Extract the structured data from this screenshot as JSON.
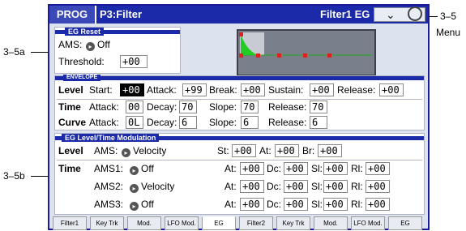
{
  "callouts": {
    "menu_ref": "3–5",
    "menu_label": "Menu",
    "eg_reset_ref": "3–5a",
    "eg_mod_ref": "3–5b"
  },
  "header": {
    "mode": "PROG",
    "page": "P3:Filter",
    "subpage": "Filter1 EG"
  },
  "eg_reset": {
    "title": "EG Reset",
    "ams_label": "AMS:",
    "ams_value": "Off",
    "threshold_label": "Threshold:",
    "threshold_value": "+00"
  },
  "envelope": {
    "title": "ENVELOPE",
    "level_label": "Level",
    "time_label": "Time",
    "curve_label": "Curve",
    "level": {
      "start_label": "Start:",
      "start": "+00",
      "attack_label": "Attack:",
      "attack": "+99",
      "break_label": "Break:",
      "break": "+00",
      "sustain_label": "Sustain:",
      "sustain": "+00",
      "release_label": "Release:",
      "release": "+00"
    },
    "time": {
      "attack_label": "Attack:",
      "attack": "00",
      "decay_label": "Decay:",
      "decay": "70",
      "slope_label": "Slope:",
      "slope": "70",
      "release_label": "Release:",
      "release": "70"
    },
    "curve": {
      "attack_label": "Attack:",
      "attack": "0L",
      "decay_label": "Decay:",
      "decay": "6",
      "slope_label": "Slope:",
      "slope": "6",
      "release_label": "Release:",
      "release": "6"
    }
  },
  "modulation": {
    "title": "EG Level/Time Modulation",
    "level_label": "Level",
    "time_label": "Time",
    "level_row": {
      "ams_label": "AMS:",
      "ams": "Velocity",
      "st_label": "St:",
      "st": "+00",
      "at_label": "At:",
      "at": "+00",
      "br_label": "Br:",
      "br": "+00"
    },
    "time_rows": [
      {
        "ams_label": "AMS1:",
        "ams": "Off",
        "at_label": "At:",
        "at": "+00",
        "dc_label": "Dc:",
        "dc": "+00",
        "sl_label": "Sl:",
        "sl": "+00",
        "rl_label": "Rl:",
        "rl": "+00"
      },
      {
        "ams_label": "AMS2:",
        "ams": "Velocity",
        "at_label": "At:",
        "at": "+00",
        "dc_label": "Dc:",
        "dc": "+00",
        "sl_label": "Sl:",
        "sl": "+00",
        "rl_label": "Rl:",
        "rl": "+00"
      },
      {
        "ams_label": "AMS3:",
        "ams": "Off",
        "at_label": "At:",
        "at": "+00",
        "dc_label": "Dc:",
        "dc": "+00",
        "sl_label": "Sl:",
        "sl": "+00",
        "rl_label": "Rl:",
        "rl": "+00"
      }
    ]
  },
  "tabs": [
    {
      "label": "Filter1"
    },
    {
      "label": "Key Trk"
    },
    {
      "label": "Mod."
    },
    {
      "label": "LFO Mod."
    },
    {
      "label": "EG"
    },
    {
      "label": "Filter2"
    },
    {
      "label": "Key Trk"
    },
    {
      "label": "Mod."
    },
    {
      "label": "LFO Mod."
    },
    {
      "label": "EG"
    }
  ],
  "active_tab": 4,
  "colors": {
    "header": "#1a2aa8",
    "envelope_fill": "#22cc22",
    "points": "#e02020"
  }
}
